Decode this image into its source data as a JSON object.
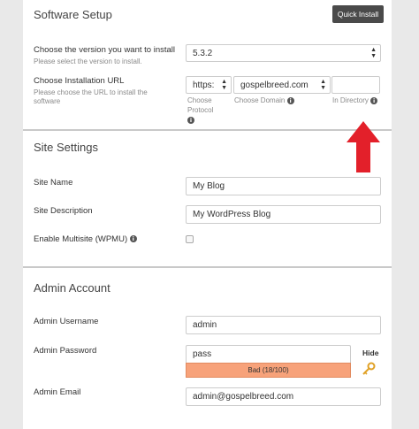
{
  "software_setup": {
    "title": "Software Setup",
    "quick_install_label": "Quick Install",
    "version_label": "Choose the version you want to install",
    "version_sublabel": "Please select the version to install.",
    "version_value": "5.3.2",
    "url_label": "Choose Installation URL",
    "url_sublabel": "Please choose the URL to install the software",
    "protocol_value": "https:",
    "domain_value": "gospelbreed.com",
    "directory_value": "",
    "protocol_hint": "Choose Protocol",
    "domain_hint": "Choose Domain",
    "directory_hint": "In Directory"
  },
  "site_settings": {
    "title": "Site Settings",
    "site_name_label": "Site Name",
    "site_name_value": "My Blog",
    "site_description_label": "Site Description",
    "site_description_value": "My WordPress Blog",
    "multisite_label": "Enable Multisite (WPMU)",
    "multisite_checked": false
  },
  "admin_account": {
    "title": "Admin Account",
    "username_label": "Admin Username",
    "username_value": "admin",
    "password_label": "Admin Password",
    "password_value": "pass",
    "hide_label": "Hide",
    "strength_label": "Bad (18/100)",
    "email_label": "Admin Email",
    "email_value": "admin@gospelbreed.com"
  },
  "icons": {
    "info": "i",
    "select_arrow": "▲▼"
  },
  "colors": {
    "arrow": "#e3202a",
    "strength_bad": "#f7a27a",
    "key": "#e0a126"
  }
}
